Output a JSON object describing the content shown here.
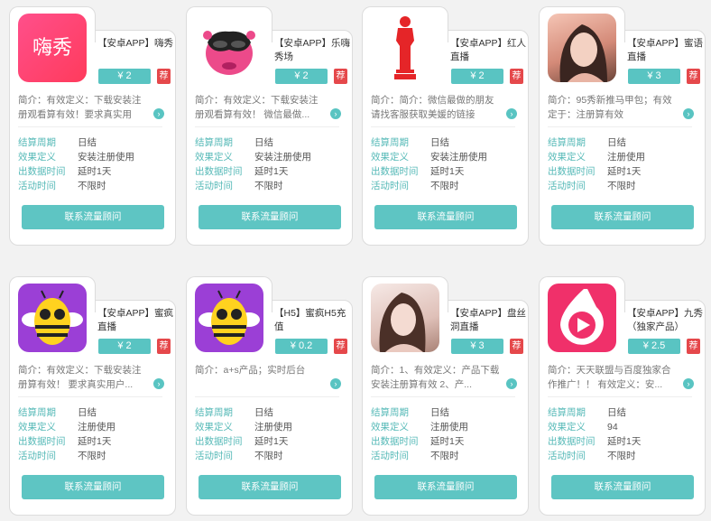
{
  "labels": {
    "settle": "结算周期",
    "effect": "效果定义",
    "data_time": "出数据时间",
    "active_time": "活动时间",
    "rec_badge": "荐",
    "contact_button": "联系流量顾问"
  },
  "cards": [
    {
      "logo_text": "嗨秀",
      "title": "【安卓APP】嗨秀",
      "price": "¥ 2",
      "intro": "简介：有效定义：下载安装注册观看算有效！要求真实用户...",
      "settle": "日结",
      "effect": "安装注册使用",
      "data_time": "延时1天",
      "active_time": "不限时"
    },
    {
      "title": "【安卓APP】乐嗨秀场",
      "price": "¥ 2",
      "intro": "简介：有效定义：下载安装注册观看算有效！ 微信最做...",
      "settle": "日结",
      "effect": "安装注册使用",
      "data_time": "延时1天",
      "active_time": "不限时"
    },
    {
      "title": "【安卓APP】红人直播",
      "price": "¥ 2",
      "intro": "简介：简介：微信最做的朋友请找客服获取美媛的链接呢。...",
      "settle": "日结",
      "effect": "安装注册使用",
      "data_time": "延时1天",
      "active_time": "不限时"
    },
    {
      "title": "【安卓APP】蜜语直播",
      "price": "¥ 3",
      "intro": "简介：95秀新推马甲包；有效定于：注册算有效",
      "settle": "日结",
      "effect": "注册使用",
      "data_time": "延时1天",
      "active_time": "不限时"
    },
    {
      "title": "【安卓APP】蜜疯直播",
      "price": "¥ 2",
      "intro": "简介：有效定义：下载安装注册算有效！ 要求真实用户...",
      "settle": "日结",
      "effect": "注册使用",
      "data_time": "延时1天",
      "active_time": "不限时"
    },
    {
      "title": "【H5】蜜疯H5充值",
      "price": "¥ 0.2",
      "intro": "简介：a+s产品；实时后台",
      "settle": "日结",
      "effect": "注册使用",
      "data_time": "延时1天",
      "active_time": "不限时"
    },
    {
      "title": "【安卓APP】盘丝洞直播",
      "price": "¥ 3",
      "intro": "简介：1、有效定义：产品下载安装注册算有效 2、产...",
      "settle": "日结",
      "effect": "注册使用",
      "data_time": "延时1天",
      "active_time": "不限时"
    },
    {
      "title": "【安卓APP】九秀（独家产品）",
      "price": "¥ 2.5",
      "intro": "简介：天天联盟与百度独家合作推广！！ 有效定义：安...",
      "settle": "日结",
      "effect": "94",
      "data_time": "延时1天",
      "active_time": "不限时"
    }
  ],
  "icons": [
    "haixiu-logo",
    "lehai-mask-logo",
    "oscar-figure-logo",
    "woman-photo",
    "bee-logo",
    "bee-logo",
    "woman-photo",
    "jiuxiu-play-logo"
  ],
  "colors": {
    "accent": "#59c4c2",
    "badge": "#e5484b",
    "pink": "#f0306a"
  }
}
